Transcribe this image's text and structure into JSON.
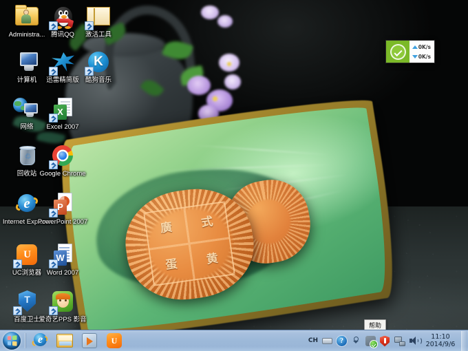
{
  "desktop": {
    "wallpaper_description": "Mooncakes on a green leaf-shaped ceramic plate with teapot and purple flowers",
    "icons": [
      {
        "label": "Administra...",
        "name": "desktop-icon-administrator-folder",
        "icon": "user-folder-icon"
      },
      {
        "label": "腾讯QQ",
        "name": "desktop-icon-tencent-qq",
        "icon": "qq-penguin-icon"
      },
      {
        "label": "激活工具",
        "name": "desktop-icon-activation-tools",
        "icon": "open-folder-icon"
      },
      {
        "label": "计算机",
        "name": "desktop-icon-computer",
        "icon": "computer-monitor-icon"
      },
      {
        "label": "迅雷精简版",
        "name": "desktop-icon-thunder-lite",
        "icon": "thunder-bird-icon"
      },
      {
        "label": "酷狗音乐",
        "name": "desktop-icon-kugou-music",
        "icon": "kugou-k-icon"
      },
      {
        "label": "网络",
        "name": "desktop-icon-network",
        "icon": "network-globe-icon"
      },
      {
        "label": "Excel 2007",
        "name": "desktop-icon-excel-2007",
        "icon": "excel-document-icon"
      },
      {
        "label": "回收站",
        "name": "desktop-icon-recycle-bin",
        "icon": "recycle-bin-icon"
      },
      {
        "label": "Google Chrome",
        "name": "desktop-icon-google-chrome",
        "icon": "chrome-icon"
      },
      {
        "label": "Internet Explorer",
        "name": "desktop-icon-internet-explorer",
        "icon": "internet-explorer-icon"
      },
      {
        "label": "PowerPoint 2007",
        "name": "desktop-icon-powerpoint-2007",
        "icon": "powerpoint-document-icon"
      },
      {
        "label": "UC浏览器",
        "name": "desktop-icon-uc-browser",
        "icon": "uc-browser-icon"
      },
      {
        "label": "Word 2007",
        "name": "desktop-icon-word-2007",
        "icon": "word-document-icon"
      },
      {
        "label": "百度卫士",
        "name": "desktop-icon-baidu-guard",
        "icon": "baidu-shield-icon"
      },
      {
        "label": "爱奇艺PPS 影音",
        "name": "desktop-icon-iqiyi-pps",
        "icon": "pps-video-icon"
      }
    ],
    "excel_letter": "X",
    "word_letter": "W",
    "powerpoint_letter": "P",
    "kugou_letter": "K",
    "uc_letter": "U",
    "ie_letter": "e",
    "shield_letter": "T",
    "bin_symbol": "♲",
    "mooncake_chars": [
      "廣",
      "式",
      "蛋",
      "黄"
    ]
  },
  "net_widget": {
    "status_icon": "green-check-icon",
    "upload_speed": "0K/s",
    "download_speed": "0K/s"
  },
  "tooltip": {
    "text": "帮助"
  },
  "taskbar": {
    "start_label": "Start",
    "pinned": [
      {
        "label": "Internet Explorer",
        "name": "taskbar-internet-explorer",
        "icon": "internet-explorer-icon"
      },
      {
        "label": "Windows 资源管理器",
        "name": "taskbar-windows-explorer",
        "icon": "folder-explorer-icon"
      },
      {
        "label": "Windows Media Player",
        "name": "taskbar-media-player",
        "icon": "media-player-icon"
      },
      {
        "label": "UC浏览器",
        "name": "taskbar-uc-browser",
        "icon": "uc-browser-icon"
      }
    ],
    "tray": {
      "language": "CH",
      "icons": [
        {
          "name": "tray-keyboard-icon",
          "title": "输入法"
        },
        {
          "name": "tray-help-icon",
          "title": "帮助"
        },
        {
          "name": "tray-show-hidden-icon",
          "title": "显示隐藏的图标"
        },
        {
          "name": "tray-action-center-icon",
          "title": "操作中心"
        },
        {
          "name": "tray-security-shield-icon",
          "title": "安全卫士"
        },
        {
          "name": "tray-network-icon",
          "title": "网络"
        },
        {
          "name": "tray-volume-icon",
          "title": "音量"
        }
      ]
    },
    "clock": {
      "time": "11:10",
      "date": "2014/9/6"
    },
    "show_desktop_label": "显示桌面"
  }
}
